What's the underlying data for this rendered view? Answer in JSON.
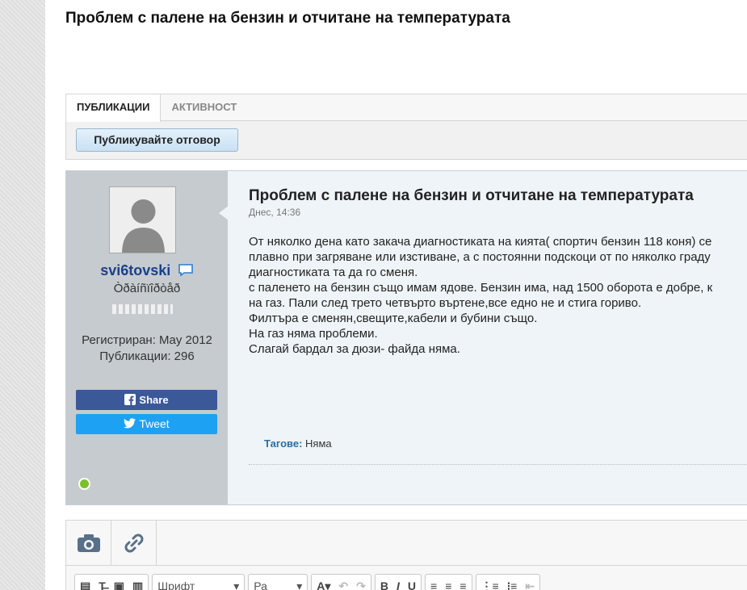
{
  "topic": {
    "title": "Проблем с палене на бензин и отчитане на температурата"
  },
  "tabs": [
    {
      "label": "ПУБЛИКАЦИИ"
    },
    {
      "label": "АКТИВНОСТ"
    }
  ],
  "reply_button": "Публикувайте отговор",
  "post": {
    "author": {
      "username": "svi6tovski",
      "rank": "Òðàíñïîðòåð",
      "registered": "Регистриран: May 2012",
      "posts_count": "Публикации: 296",
      "online": true
    },
    "share_label": "Share",
    "tweet_label": "Tweet",
    "title": "Проблем с палене на бензин и отчитане на температурата",
    "date": "Днес, 14:36",
    "body_lines": [
      "От няколко дена като закача диагностиката на кията( спортич бензин 118 коня) се",
      "плавно при загряване или изстиване, а с постоянни подскоци от по няколко граду",
      "диагностиката та да го сменя.",
      "с паленето на бензин също имам ядове. Бензин има, над 1500 оборота е добре, к",
      "на газ. Пали след трето четвърто въртене,все едно не и стига гориво.",
      "Филтъра е сменян,свещите,кабели и бубини също.",
      "На газ няма проблеми.",
      "Слагай бардал за дюзи- файда няма."
    ],
    "tags_label": "Тагове:",
    "tags_value": "Няма"
  },
  "editor": {
    "font_select": "Шрифт",
    "size_select": "Ра",
    "text_color": "A",
    "bold": "B",
    "italic": "I",
    "underline": "U"
  },
  "colors": {
    "username": "#1a3f8c",
    "facebook": "#3b5998",
    "twitter": "#1da1f2",
    "online": "#7bbf2a"
  }
}
